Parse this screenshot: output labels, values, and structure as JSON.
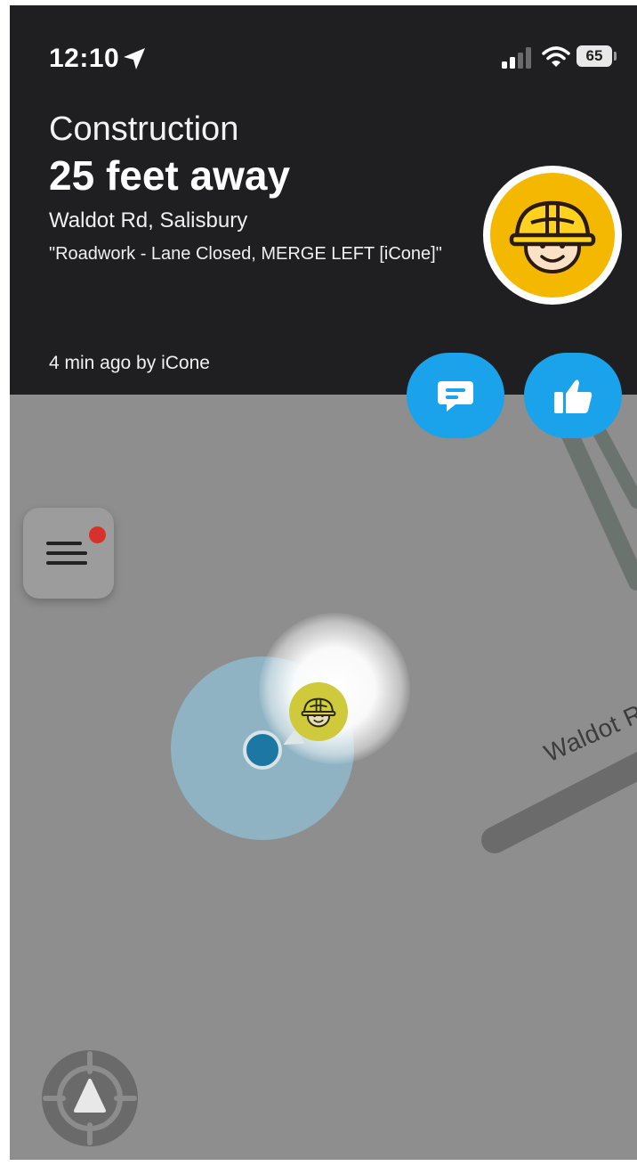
{
  "status_bar": {
    "time": "12:10",
    "battery": "65"
  },
  "alert": {
    "type": "Construction",
    "distance": "25 feet away",
    "location": "Waldot Rd, Salisbury",
    "description": "\"Roadwork - Lane Closed, MERGE LEFT [iCone]\"",
    "meta": "4 min ago by iCone",
    "icon": "construction-worker-icon"
  },
  "actions": {
    "comment_icon": "comment-icon",
    "thumbs_up_icon": "thumbs-up-icon"
  },
  "map": {
    "street_label": "Waldot R",
    "menu_icon": "menu-icon",
    "recenter_icon": "recenter-icon"
  },
  "colors": {
    "header_background": "#1f1f21",
    "accent_blue": "#1aa3ea",
    "alert_yellow": "#f5b800",
    "map_background": "#8e8e8e",
    "notification_red": "#d8312c"
  }
}
